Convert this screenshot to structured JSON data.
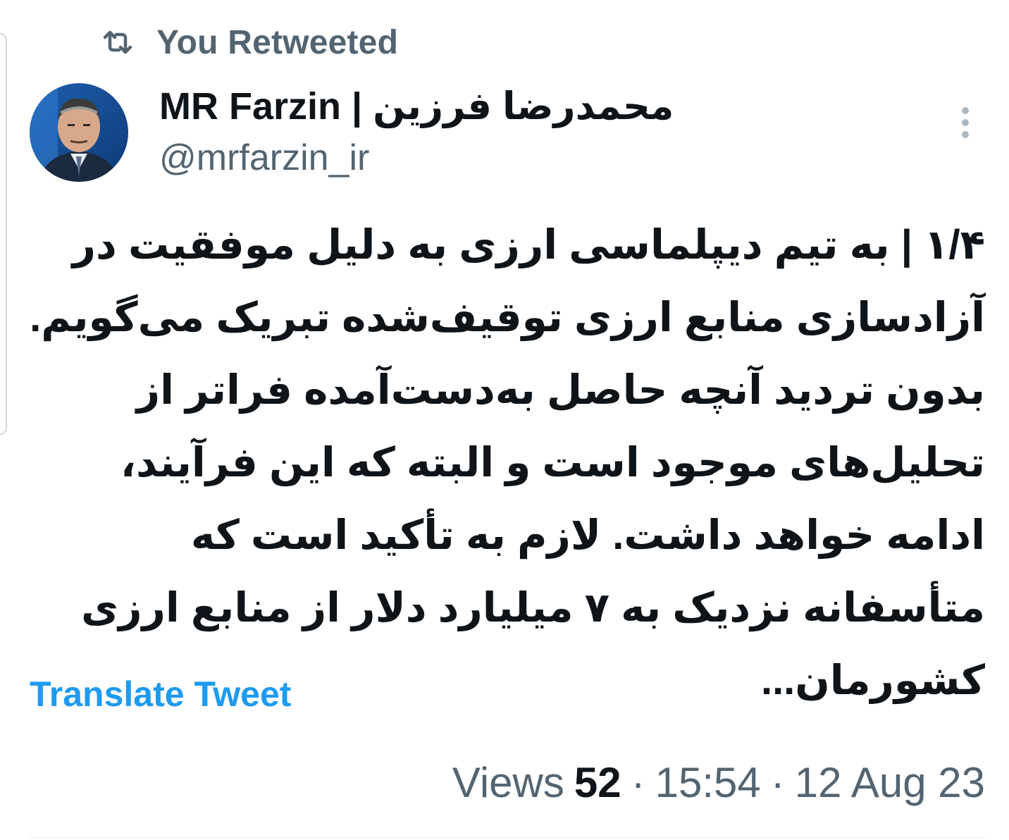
{
  "retweet": {
    "icon": "retweet-icon",
    "label": "You Retweeted"
  },
  "author": {
    "display_name": "MR Farzin | محمدرضا فرزین",
    "handle": "@mrfarzin_ir",
    "avatar_icon": "profile-photo"
  },
  "more_icon": "more-vertical-icon",
  "tweet": {
    "text": "۱/۴ | به تیم دیپلماسی ارزی به دلیل موفقیت در آزادسازی منابع ارزی توقیف‌شده تبریک می‌گویم. بدون تردید آنچه حاصل به‌دست‌آمده فراتر از تحلیل‌های موجود است و البته که این فرآیند، ادامه خواهد داشت. لازم به تأکید است که متأسفانه نزدیک به ۷ میلیارد دلار از منابع ارزی کشورمان..."
  },
  "translate_label": "Translate Tweet",
  "meta": {
    "views_label": "Views",
    "views_count": "52",
    "separator": "·",
    "time": "15:54",
    "date": "12 Aug 23"
  },
  "colors": {
    "text": "#0f1419",
    "secondary": "#536471",
    "link": "#1d9bf0"
  }
}
